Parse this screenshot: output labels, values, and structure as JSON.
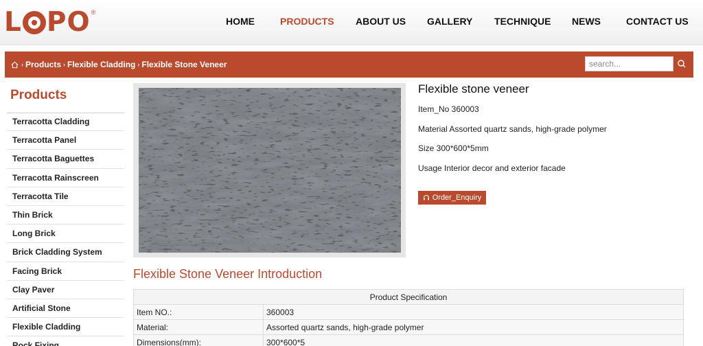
{
  "brand": {
    "logo_text": "LOPO",
    "logo_reg": "®",
    "accent": "#b94a2e"
  },
  "nav": [
    {
      "label": "HOME",
      "active": false
    },
    {
      "label": "PRODUCTS",
      "active": true
    },
    {
      "label": "ABOUT US",
      "active": false
    },
    {
      "label": "GALLERY",
      "active": false
    },
    {
      "label": "TECHNIQUE",
      "active": false
    },
    {
      "label": "NEWS",
      "active": false
    },
    {
      "label": "CONTACT US",
      "active": false
    }
  ],
  "breadcrumb": {
    "home_icon": "home-icon",
    "items": [
      "Products",
      "Flexible Cladding",
      "Flexible Stone Veneer"
    ]
  },
  "search": {
    "placeholder": "search...",
    "icon": "search-icon"
  },
  "sidebar": {
    "title": "Products",
    "items": [
      "Terracotta Cladding",
      "Terracotta Panel",
      "Terracotta Baguettes",
      "Terracotta Rainscreen",
      "Terracotta Tile",
      "Thin Brick",
      "Long Brick",
      "Brick Cladding System",
      "Facing Brick",
      "Clay Paver",
      "Artificial Stone",
      "Flexible Cladding",
      "Rock Fixing"
    ]
  },
  "product": {
    "image": "gray travertine-textured stone veneer sample",
    "title": "Flexible stone veneer",
    "item_no": "Item_No 360003",
    "material": "Material Assorted quartz sands, high-grade polymer",
    "size": "Size 300*600*5mm",
    "usage": "Usage Interior decor and exterior facade",
    "order_label": "Order_Enquiry",
    "order_icon": "headset-icon"
  },
  "intro": {
    "title": "Flexible Stone Veneer Introduction"
  },
  "spec": {
    "header": "Product Specification",
    "rows": [
      [
        "Item NO.:",
        "360003"
      ],
      [
        "Material:",
        "Assorted quartz sands, high-grade polymer"
      ],
      [
        "Dimensions(mm):",
        "300*600*5"
      ]
    ]
  }
}
